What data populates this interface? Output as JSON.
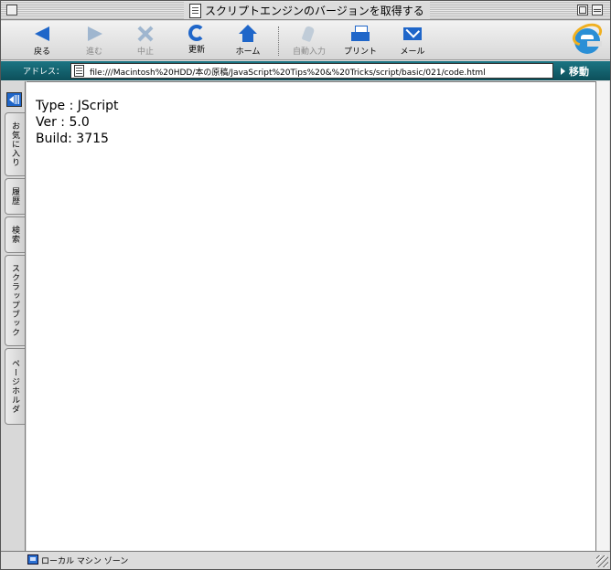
{
  "window": {
    "title": "スクリプトエンジンのバージョンを取得する"
  },
  "toolbar": {
    "back": "戻る",
    "forward": "進む",
    "stop": "中止",
    "refresh": "更新",
    "home": "ホーム",
    "autofill": "自動入力",
    "print": "プリント",
    "mail": "メール"
  },
  "address": {
    "label": "アドレス：",
    "url": "file:///Macintosh%20HDD/本の原稿/JavaScript%20Tips%20&%20Tricks/script/basic/021/code.html",
    "go_label": "移動"
  },
  "sidebar": {
    "tabs": [
      "お気に入り",
      "履歴",
      "検索",
      "スクラップブック",
      "ページホルダ"
    ]
  },
  "content": {
    "lines": [
      "Type : JScript",
      "Ver : 5.0",
      "Build: 3715"
    ]
  },
  "status": {
    "zone": "ローカル マシン ゾーン"
  }
}
